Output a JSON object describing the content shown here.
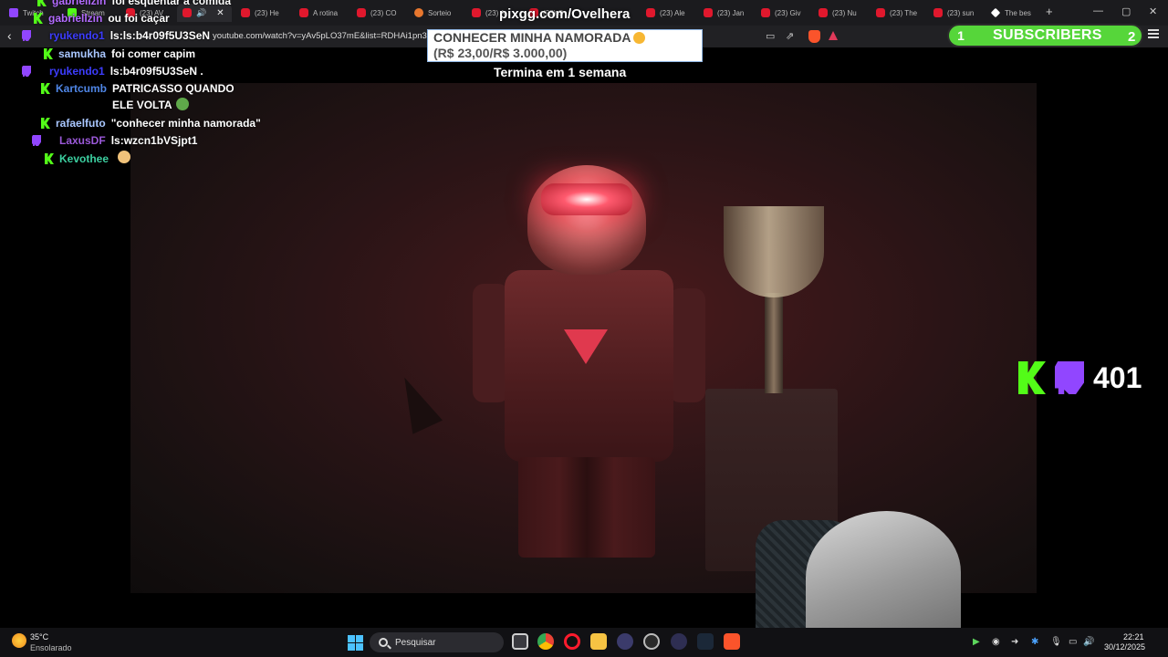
{
  "browser": {
    "tabs": [
      {
        "label": "Twitch",
        "favicon": "twitch-icon"
      },
      {
        "label": "Stream",
        "favicon": "kick-icon"
      },
      {
        "label": "(23) AV",
        "favicon": "youtube-icon"
      },
      {
        "label": "(23) He",
        "favicon": "youtube-icon"
      },
      {
        "label": "A rotina",
        "favicon": "youtube-icon"
      },
      {
        "label": "(23) CO",
        "favicon": "youtube-icon"
      },
      {
        "label": "Sorteio",
        "favicon": "sorteio-icon"
      },
      {
        "label": "(23) A",
        "favicon": "youtube-icon"
      },
      {
        "label": "(23) Q",
        "favicon": "youtube-icon"
      },
      {
        "label": "(23) Q",
        "favicon": "youtube-icon"
      },
      {
        "label": "(23) Ale",
        "favicon": "youtube-icon"
      },
      {
        "label": "(23) Jan",
        "favicon": "youtube-icon"
      },
      {
        "label": "(23) Giv",
        "favicon": "youtube-icon"
      },
      {
        "label": "(23) Nu",
        "favicon": "youtube-icon"
      },
      {
        "label": "(23) The",
        "favicon": "youtube-icon"
      },
      {
        "label": "(23) sun",
        "favicon": "youtube-icon"
      },
      {
        "label": "The bes",
        "favicon": "diamond-icon"
      }
    ],
    "active_tab_index": 3,
    "address": "youtube.com/watch?v=yAv5pLO37mE&list=RDHAi1pn3k"
  },
  "chat": {
    "messages": [
      {
        "badge": "kick",
        "user": "gabriellzin",
        "user_color": "#b36bff",
        "text": "foi esquentar a comida"
      },
      {
        "badge": "kick",
        "user": "gabriellzin",
        "user_color": "#b36bff",
        "text": "ou foi caçar"
      },
      {
        "badge": "twitch",
        "user": "ryukendo1",
        "user_color": "#3d3dff",
        "text": "ls:ls:b4r09f5U3SeN"
      },
      {
        "badge": "kick",
        "user": "samukha",
        "user_color": "#a9c7ff",
        "text": "foi comer capim"
      },
      {
        "badge": "twitch",
        "user": "ryukendo1",
        "user_color": "#3d3dff",
        "text": "ls:b4r09f5U3SeN ."
      },
      {
        "badge": "kick",
        "user": "Kartcumb",
        "user_color": "#4f86e6",
        "text": "PATRICASSO QUANDO ELE VOLTA"
      },
      {
        "badge": "kick",
        "user": "rafaelfuto",
        "user_color": "#a9c7ff",
        "text": "\"conhecer minha namorada\""
      },
      {
        "badge": "twitch",
        "user": "LaxusDF",
        "user_color": "#9b59d9",
        "text": "ls:wzcn1bVSjpt1"
      },
      {
        "badge": "kick",
        "user": "Kevothee",
        "user_color": "#3ccfa0",
        "text": ""
      }
    ]
  },
  "overlay": {
    "pix_title": "pixgg.com/Ovelhera",
    "goal_line1": "CONHECER MINHA NAMORADA",
    "goal_line2": "(R$ 23,00/R$ 3.000,00)",
    "goal_current": 23,
    "goal_target": 3000,
    "ends_in": "Termina em 1 semana"
  },
  "subscribers": {
    "count": "1",
    "label": "SUBSCRIBERS",
    "right_value": "2"
  },
  "viewers": {
    "count": "401"
  },
  "taskbar": {
    "weather_temp": "35°C",
    "weather_desc": "Ensolarado",
    "search_placeholder": "Pesquisar",
    "time": "22:21",
    "date": "30/12/2025"
  },
  "colors": {
    "kick_green": "#53fc18",
    "twitch_purple": "#9146ff",
    "subs_green": "#56d63a"
  }
}
